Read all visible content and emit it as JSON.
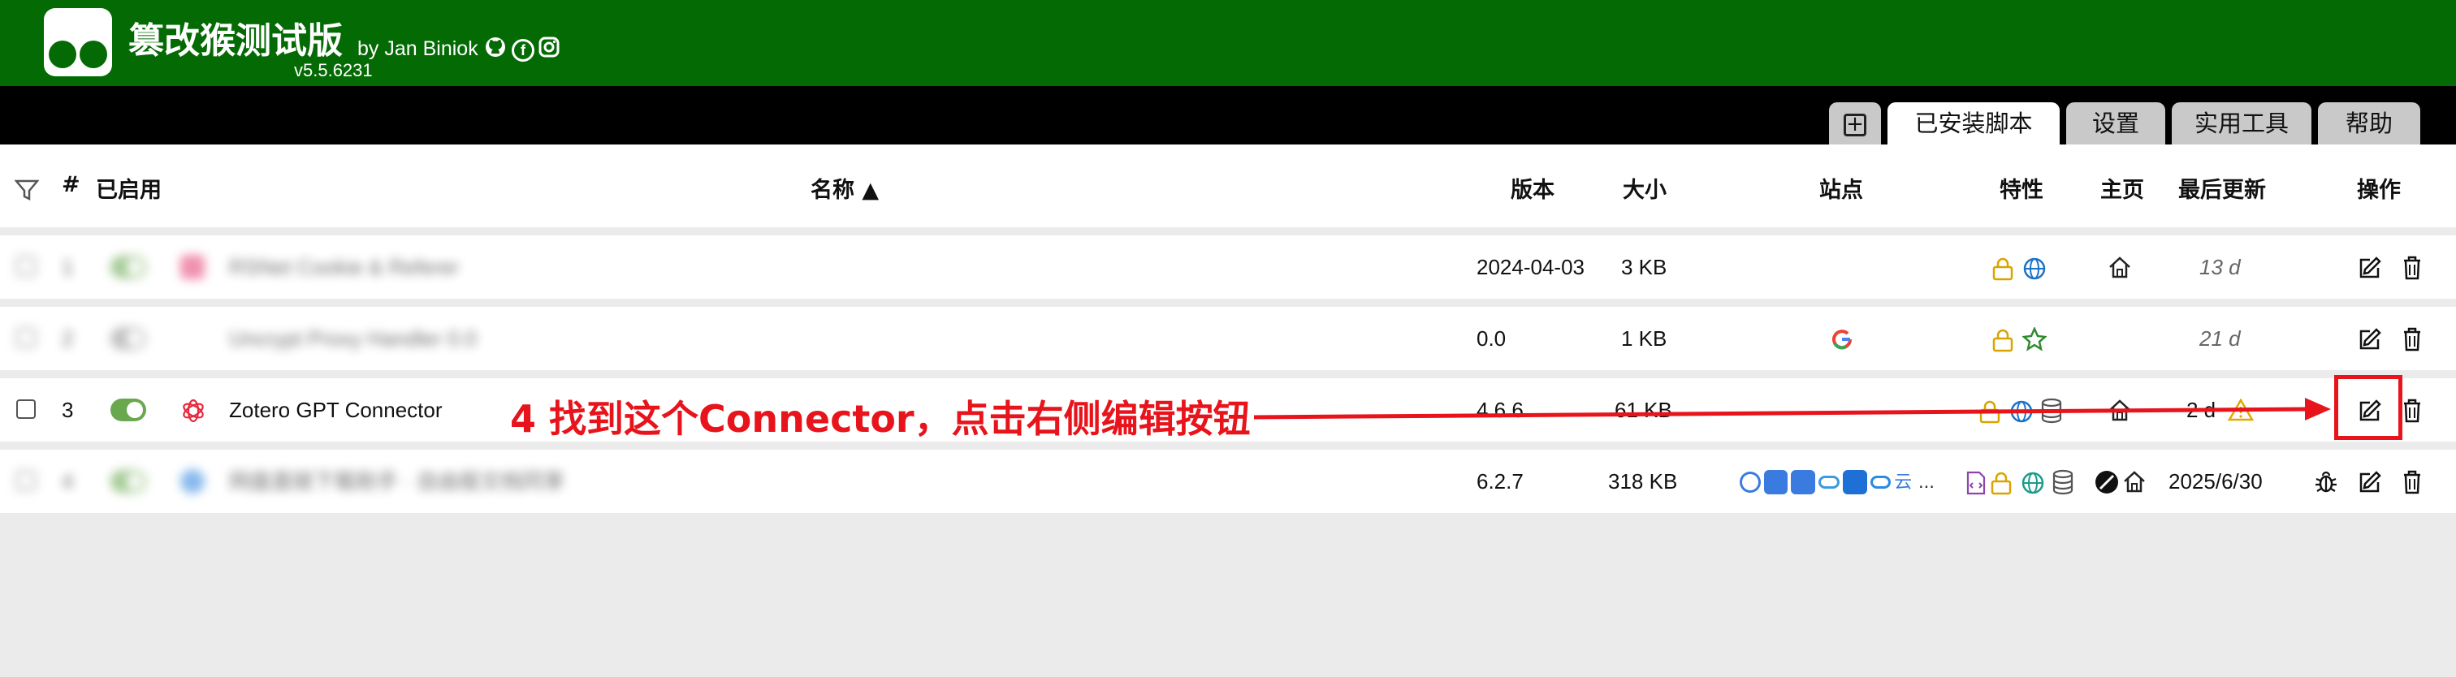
{
  "header": {
    "title": "篡改猴测试版",
    "byline": "by Jan Biniok",
    "version": "v5.5.6231",
    "social_icons": [
      "github-icon",
      "facebook-icon",
      "instagram-icon"
    ]
  },
  "tabs": {
    "add_icon": "plus-square-icon",
    "items": [
      {
        "label": "已安装脚本",
        "active": true
      },
      {
        "label": "设置",
        "active": false
      },
      {
        "label": "实用工具",
        "active": false
      },
      {
        "label": "帮助",
        "active": false
      }
    ]
  },
  "table": {
    "columns": {
      "num": "#",
      "enabled": "已启用",
      "name": "名称 ▲",
      "version": "版本",
      "size": "大小",
      "sites": "站点",
      "features": "特性",
      "homepage": "主页",
      "updated": "最后更新",
      "actions": "操作"
    },
    "rows": [
      {
        "num": "1",
        "name": "RSNet Cookie & Referer",
        "version": "2024-04-03",
        "size": "3 KB",
        "updated": "13 d",
        "blurred": true
      },
      {
        "num": "2",
        "name": "Uncrypt Proxy Handler 0.0",
        "version": "0.0",
        "size": "1 KB",
        "updated": "21 d",
        "blurred": true
      },
      {
        "num": "3",
        "name": "Zotero GPT Connector",
        "version": "4.6.6",
        "size": "61 KB",
        "updated": "2 d",
        "blurred": false
      },
      {
        "num": "4",
        "name": "网盘直链下载助手 · 自由版文档同享",
        "version": "6.2.7",
        "size": "318 KB",
        "updated": "2025/6/30",
        "blurred": true
      }
    ]
  },
  "annotation": {
    "text": "4 找到这个Connector，点击右侧编辑按钮",
    "color": "#e8141c"
  },
  "colors": {
    "header_green": "#046a04",
    "toggle_green": "#6aa84f",
    "lock_yellow": "#d9a400",
    "globe_blue": "#1a73c9"
  }
}
